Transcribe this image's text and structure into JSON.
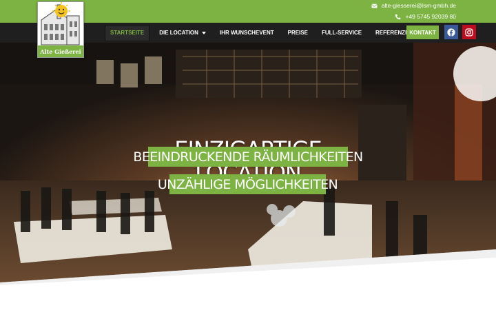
{
  "topbar": {
    "email": "alte-giesserei@lsm-gmbh.de",
    "phone": "+49 5745 92039 80"
  },
  "logo": {
    "name": "Alte Gießerei"
  },
  "nav": {
    "items": [
      {
        "label": "STARTSEITE"
      },
      {
        "label": "DIE LOCATION"
      },
      {
        "label": "IHR WUNSCHEVENT"
      },
      {
        "label": "PREISE"
      },
      {
        "label": "FULL-SERVICE"
      },
      {
        "label": "REFERENZEN"
      }
    ],
    "cta": "KONTAKT",
    "social": [
      "facebook-icon",
      "instagram-icon"
    ]
  },
  "hero": {
    "title_line1": "EINZIGARTIGE",
    "title_line2": "LOCATION",
    "tagline1": "BEEINDRUCKENDE RÄUMLICHKEITEN",
    "tagline2": "UNZÄHLIGE MÖGLICHKEITEN"
  },
  "colors": {
    "accent_green": "#7cb342",
    "nav_dark": "#1f1f1f",
    "facebook_blue": "#3b5998",
    "instagram_red": "#c00b1f"
  }
}
